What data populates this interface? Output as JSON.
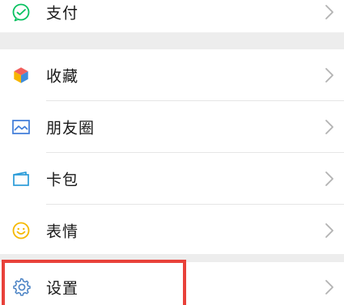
{
  "menu": {
    "pay": {
      "label": "支付",
      "icon": "wechat-pay-icon"
    },
    "favorites": {
      "label": "收藏",
      "icon": "cube-icon"
    },
    "moments": {
      "label": "朋友圈",
      "icon": "picture-icon"
    },
    "cards": {
      "label": "卡包",
      "icon": "card-wallet-icon"
    },
    "stickers": {
      "label": "表情",
      "icon": "smiley-icon"
    },
    "settings": {
      "label": "设置",
      "icon": "gear-icon"
    }
  },
  "highlight": {
    "target": "settings",
    "color": "#e8413a"
  },
  "colors": {
    "background": "#ededed",
    "row": "#ffffff",
    "text": "#191919",
    "pay_green": "#07c160",
    "moments_blue": "#3d7bd9",
    "cards_blue": "#2a9cd9",
    "stickers_yellow": "#f5b800",
    "settings_blue": "#4a82c4",
    "chevron": "#b2b2b2"
  }
}
